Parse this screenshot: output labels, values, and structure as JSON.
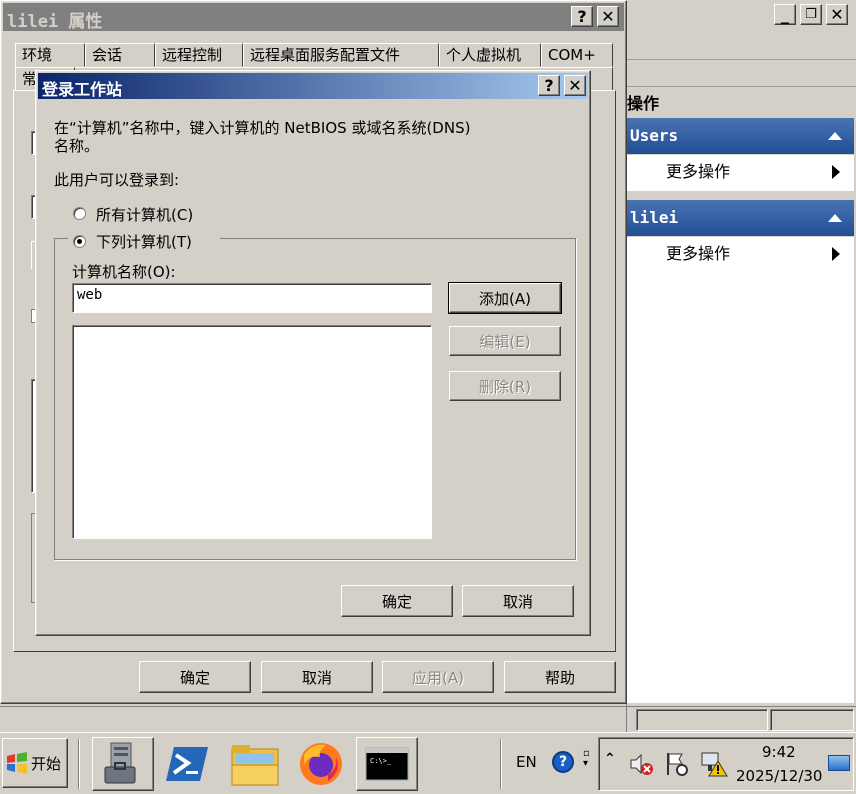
{
  "properties_window": {
    "title": "lilei 属性",
    "tabs_row1": [
      "环境",
      "会话",
      "远程控制",
      "远程桌面服务配置文件",
      "个人虚拟机",
      "COM+"
    ],
    "tab_row2_partial": "常",
    "buttons": {
      "ok": "确定",
      "cancel": "取消",
      "apply": "应用(A)",
      "help": "帮助"
    }
  },
  "dialog": {
    "title": "登录工作站",
    "description": "在“计算机”名称中，键入计算机的 NetBIOS 或域名系统(DNS) 名称。",
    "line1": "在“计算机”名称中，键入计算机的 NetBIOS 或域名系统(DNS)",
    "line2": "名称。",
    "can_logon_label": "此用户可以登录到:",
    "radio_all": "所有计算机(C)",
    "radio_following": "下列计算机(T)",
    "selected_radio": "following",
    "computer_name_label": "计算机名称(O):",
    "computer_name_value": "web",
    "computer_list": [],
    "buttons": {
      "add": "添加(A)",
      "edit": "编辑(E)",
      "remove": "删除(R)",
      "ok": "确定",
      "cancel": "取消"
    }
  },
  "actions_pane": {
    "header": "操作",
    "sections": [
      {
        "title": "Users",
        "item": "更多操作"
      },
      {
        "title": "lilei",
        "item": "更多操作"
      }
    ]
  },
  "taskbar": {
    "start_label": "开始",
    "language": "EN",
    "time": "9:42",
    "date": "2025/12/30",
    "pinned": [
      "server-manager-icon",
      "powershell-icon",
      "file-explorer-icon",
      "firefox-icon",
      "command-prompt-icon"
    ]
  },
  "colors": {
    "titlebar_inactive": "#808080",
    "titlebar_active_start": "#0a246a",
    "titlebar_active_end": "#a6caf0",
    "section_header": "#2f5ea3"
  }
}
